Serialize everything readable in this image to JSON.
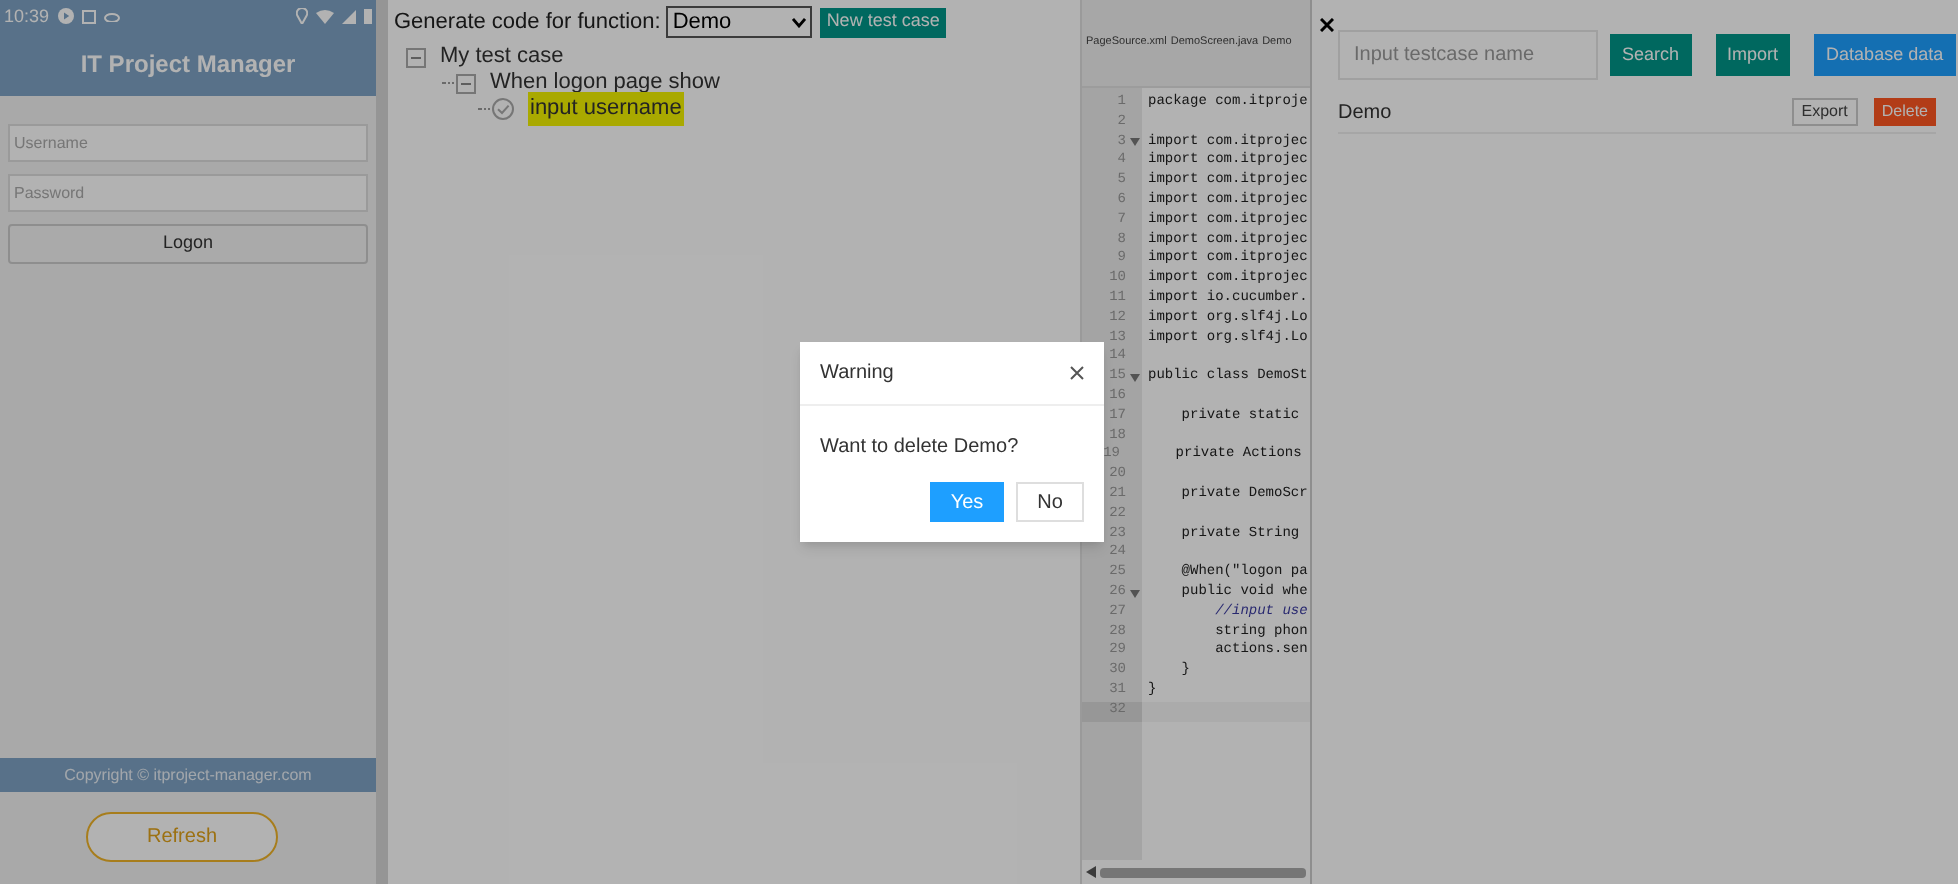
{
  "phone": {
    "status_time": "10:39",
    "title": "IT Project Manager",
    "username": {
      "placeholder": "Username"
    },
    "password": {
      "placeholder": "Password"
    },
    "logon_button": "Logon",
    "footer": "Copyright © itproject-manager.com",
    "refresh_button": "Refresh"
  },
  "generator": {
    "label": "Generate code for function:",
    "function_select": {
      "value": "Demo"
    },
    "new_button": "New test case",
    "tree": [
      {
        "label": "My test case",
        "kind": "group",
        "expanded": true,
        "selected": false,
        "children": [
          {
            "label": "When logon page show",
            "kind": "group",
            "expanded": true,
            "selected": false,
            "children": [
              {
                "label": "input username",
                "kind": "step",
                "selected": true
              }
            ]
          }
        ]
      }
    ]
  },
  "editor": {
    "tabs": [
      "PageSource.xml",
      "DemoScreen.java",
      "Demo"
    ],
    "lines": [
      {
        "number": "1",
        "code": "package com.itproje"
      },
      {
        "number": "2"
      },
      {
        "number": "3",
        "code": "import com.itprojec",
        "fold": true
      },
      {
        "number": "4",
        "code": "import com.itprojec"
      },
      {
        "number": "5",
        "code": "import com.itprojec"
      },
      {
        "number": "6",
        "code": "import com.itprojec"
      },
      {
        "number": "7",
        "code": "import com.itprojec"
      },
      {
        "number": "8",
        "code": "import com.itprojec"
      },
      {
        "number": "9",
        "code": "import com.itprojec"
      },
      {
        "number": "10",
        "code": "import com.itprojec"
      },
      {
        "number": "11",
        "code": "import io.cucumber."
      },
      {
        "number": "12",
        "code": "import org.slf4j.Lo"
      },
      {
        "number": "13",
        "code": "import org.slf4j.Lo"
      },
      {
        "number": "14"
      },
      {
        "number": "15",
        "code": "public class DemoSt",
        "fold": true
      },
      {
        "number": "16"
      },
      {
        "number": "17",
        "code": "    private static "
      },
      {
        "number": "18"
      },
      {
        "number": "19",
        "code": "    private Actions "
      },
      {
        "number": "20"
      },
      {
        "number": "21",
        "code": "    private DemoScr"
      },
      {
        "number": "22"
      },
      {
        "number": "23",
        "code": "    private String "
      },
      {
        "number": "24"
      },
      {
        "number": "25",
        "code": "    @When(\"logon pa"
      },
      {
        "number": "26",
        "code": "    public void whe",
        "fold": true
      },
      {
        "number": "27",
        "code": "        //input use",
        "kind": "comment"
      },
      {
        "number": "28",
        "code": "        string phon"
      },
      {
        "number": "29",
        "code": "        actions.sen"
      },
      {
        "number": "30",
        "code": "    }"
      },
      {
        "number": "31",
        "code": "}"
      },
      {
        "number": "32",
        "active": true
      }
    ]
  },
  "testcases": {
    "search": {
      "placeholder": "Input testcase name"
    },
    "buttons": [
      {
        "label": "Search",
        "kind": "primary"
      },
      {
        "label": "Import",
        "kind": "primary"
      },
      {
        "label": "Database data",
        "kind": "info"
      }
    ],
    "rows": [
      {
        "name": "Demo",
        "export_button": "Export",
        "delete_button": "Delete"
      }
    ]
  },
  "dialog": {
    "title": "Warning",
    "message": "Want to delete Demo?",
    "yes_button": "Yes",
    "no_button": "No"
  }
}
